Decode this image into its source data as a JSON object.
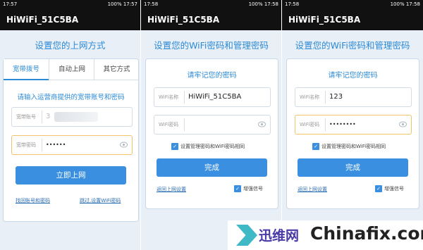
{
  "screens": [
    {
      "status": {
        "time": "17:57",
        "right": "100% 17:57"
      },
      "title": "HiWiFi_51C5BA",
      "heading": "设置您的上网方式",
      "tabs": [
        "宽带拨号",
        "自动上网",
        "其它方式"
      ],
      "active_tab": 0,
      "prompt": "请输入运营商提供的宽带账号和密码",
      "fields": [
        {
          "label": "宽带账号",
          "value": "3"
        },
        {
          "label": "宽带密码",
          "value": "••••••"
        }
      ],
      "button": "立即上网",
      "link_left": "找回账号和密码",
      "link_right": "跳过,设置WiFi密码"
    },
    {
      "status": {
        "time": "17:58",
        "right": "100% 17:58"
      },
      "title": "HiWiFi_51C5BA",
      "heading": "设置您的WiFi密码和管理密码",
      "prompt": "请牢记您的密码",
      "fields": [
        {
          "label": "WiFi名称",
          "value": "HiWiFi_51C5BA"
        },
        {
          "label": "WiFi密码",
          "value": ""
        }
      ],
      "checkbox": "设置管理密码和WiFi密码相同",
      "button": "完成",
      "link_left": "返回上网设置",
      "signal_option": "增强信号"
    },
    {
      "status": {
        "time": "17:58",
        "right": "100% 17:58"
      },
      "title": "HiWiFi_51C5BA",
      "heading": "设置您的WiFi密码和管理密码",
      "prompt": "请牢记您的密码",
      "fields": [
        {
          "label": "WiFi名称",
          "value": "123"
        },
        {
          "label": "WiFi密码",
          "value": "••••••••"
        }
      ],
      "checkbox": "设置管理密码和WiFi密码相同",
      "button": "完成",
      "link_left": "返回上网设置",
      "signal_option": "增强信号"
    }
  ],
  "watermark": {
    "cn": "迅维网",
    "en": "Chinafix.com"
  },
  "colors": {
    "accent": "#3a8fe0",
    "heading": "#2b8ad6",
    "background": "#e9eff6"
  }
}
